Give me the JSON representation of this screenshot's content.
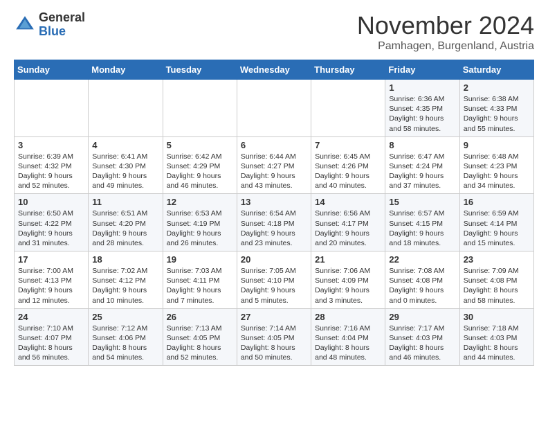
{
  "header": {
    "logo_general": "General",
    "logo_blue": "Blue",
    "month_title": "November 2024",
    "location": "Pamhagen, Burgenland, Austria"
  },
  "weekdays": [
    "Sunday",
    "Monday",
    "Tuesday",
    "Wednesday",
    "Thursday",
    "Friday",
    "Saturday"
  ],
  "weeks": [
    [
      {
        "day": "",
        "info": ""
      },
      {
        "day": "",
        "info": ""
      },
      {
        "day": "",
        "info": ""
      },
      {
        "day": "",
        "info": ""
      },
      {
        "day": "",
        "info": ""
      },
      {
        "day": "1",
        "info": "Sunrise: 6:36 AM\nSunset: 4:35 PM\nDaylight: 9 hours\nand 58 minutes."
      },
      {
        "day": "2",
        "info": "Sunrise: 6:38 AM\nSunset: 4:33 PM\nDaylight: 9 hours\nand 55 minutes."
      }
    ],
    [
      {
        "day": "3",
        "info": "Sunrise: 6:39 AM\nSunset: 4:32 PM\nDaylight: 9 hours\nand 52 minutes."
      },
      {
        "day": "4",
        "info": "Sunrise: 6:41 AM\nSunset: 4:30 PM\nDaylight: 9 hours\nand 49 minutes."
      },
      {
        "day": "5",
        "info": "Sunrise: 6:42 AM\nSunset: 4:29 PM\nDaylight: 9 hours\nand 46 minutes."
      },
      {
        "day": "6",
        "info": "Sunrise: 6:44 AM\nSunset: 4:27 PM\nDaylight: 9 hours\nand 43 minutes."
      },
      {
        "day": "7",
        "info": "Sunrise: 6:45 AM\nSunset: 4:26 PM\nDaylight: 9 hours\nand 40 minutes."
      },
      {
        "day": "8",
        "info": "Sunrise: 6:47 AM\nSunset: 4:24 PM\nDaylight: 9 hours\nand 37 minutes."
      },
      {
        "day": "9",
        "info": "Sunrise: 6:48 AM\nSunset: 4:23 PM\nDaylight: 9 hours\nand 34 minutes."
      }
    ],
    [
      {
        "day": "10",
        "info": "Sunrise: 6:50 AM\nSunset: 4:22 PM\nDaylight: 9 hours\nand 31 minutes."
      },
      {
        "day": "11",
        "info": "Sunrise: 6:51 AM\nSunset: 4:20 PM\nDaylight: 9 hours\nand 28 minutes."
      },
      {
        "day": "12",
        "info": "Sunrise: 6:53 AM\nSunset: 4:19 PM\nDaylight: 9 hours\nand 26 minutes."
      },
      {
        "day": "13",
        "info": "Sunrise: 6:54 AM\nSunset: 4:18 PM\nDaylight: 9 hours\nand 23 minutes."
      },
      {
        "day": "14",
        "info": "Sunrise: 6:56 AM\nSunset: 4:17 PM\nDaylight: 9 hours\nand 20 minutes."
      },
      {
        "day": "15",
        "info": "Sunrise: 6:57 AM\nSunset: 4:15 PM\nDaylight: 9 hours\nand 18 minutes."
      },
      {
        "day": "16",
        "info": "Sunrise: 6:59 AM\nSunset: 4:14 PM\nDaylight: 9 hours\nand 15 minutes."
      }
    ],
    [
      {
        "day": "17",
        "info": "Sunrise: 7:00 AM\nSunset: 4:13 PM\nDaylight: 9 hours\nand 12 minutes."
      },
      {
        "day": "18",
        "info": "Sunrise: 7:02 AM\nSunset: 4:12 PM\nDaylight: 9 hours\nand 10 minutes."
      },
      {
        "day": "19",
        "info": "Sunrise: 7:03 AM\nSunset: 4:11 PM\nDaylight: 9 hours\nand 7 minutes."
      },
      {
        "day": "20",
        "info": "Sunrise: 7:05 AM\nSunset: 4:10 PM\nDaylight: 9 hours\nand 5 minutes."
      },
      {
        "day": "21",
        "info": "Sunrise: 7:06 AM\nSunset: 4:09 PM\nDaylight: 9 hours\nand 3 minutes."
      },
      {
        "day": "22",
        "info": "Sunrise: 7:08 AM\nSunset: 4:08 PM\nDaylight: 9 hours\nand 0 minutes."
      },
      {
        "day": "23",
        "info": "Sunrise: 7:09 AM\nSunset: 4:08 PM\nDaylight: 8 hours\nand 58 minutes."
      }
    ],
    [
      {
        "day": "24",
        "info": "Sunrise: 7:10 AM\nSunset: 4:07 PM\nDaylight: 8 hours\nand 56 minutes."
      },
      {
        "day": "25",
        "info": "Sunrise: 7:12 AM\nSunset: 4:06 PM\nDaylight: 8 hours\nand 54 minutes."
      },
      {
        "day": "26",
        "info": "Sunrise: 7:13 AM\nSunset: 4:05 PM\nDaylight: 8 hours\nand 52 minutes."
      },
      {
        "day": "27",
        "info": "Sunrise: 7:14 AM\nSunset: 4:05 PM\nDaylight: 8 hours\nand 50 minutes."
      },
      {
        "day": "28",
        "info": "Sunrise: 7:16 AM\nSunset: 4:04 PM\nDaylight: 8 hours\nand 48 minutes."
      },
      {
        "day": "29",
        "info": "Sunrise: 7:17 AM\nSunset: 4:03 PM\nDaylight: 8 hours\nand 46 minutes."
      },
      {
        "day": "30",
        "info": "Sunrise: 7:18 AM\nSunset: 4:03 PM\nDaylight: 8 hours\nand 44 minutes."
      }
    ]
  ]
}
